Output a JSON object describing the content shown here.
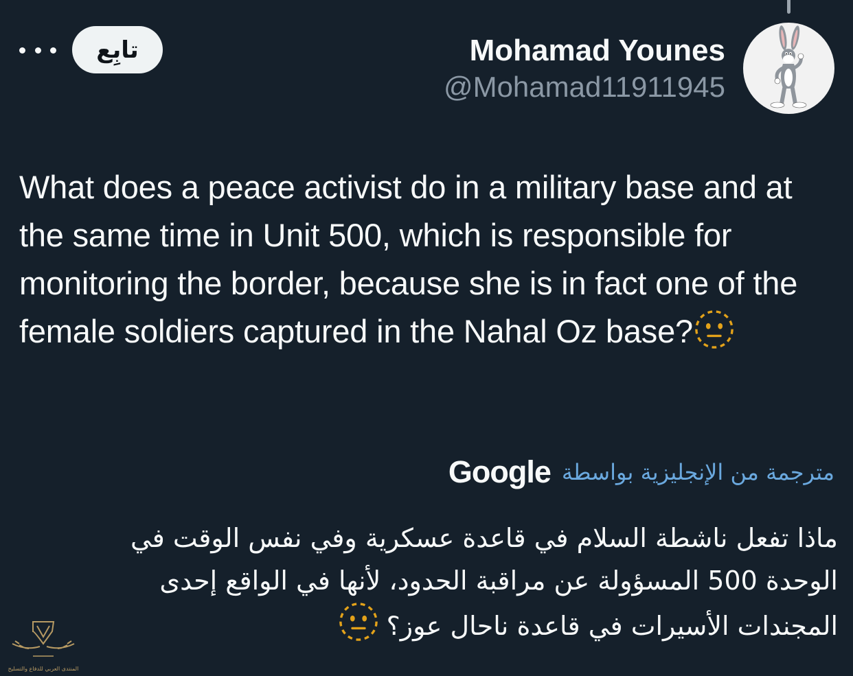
{
  "author": {
    "display_name": "Mohamad Younes",
    "handle": "@Mohamad11911945",
    "avatar_icon": "cartoon-rabbit-avatar"
  },
  "actions": {
    "follow_label": "تابِع",
    "more_icon": "more-horizontal-icon"
  },
  "tweet": {
    "text": "What does a peace activist do in a military base and at the same time in Unit 500, which is responsible for monitoring the border, because she is in fact one of the female soldiers captured in the Nahal Oz base?",
    "emoji": "neutral-face-dotted-emoji"
  },
  "translation": {
    "label": "مترجمة من الإنجليزية بواسطة",
    "provider": "Google",
    "text": "ماذا تفعل ناشطة السلام في قاعدة عسكرية وفي نفس الوقت في الوحدة 500 المسؤولة عن مراقبة الحدود، لأنها في الواقع إحدى المجندات الأسيرات في قاعدة ناحال عوز؟",
    "emoji": "neutral-face-dotted-emoji"
  },
  "watermark": {
    "text": "المنتدى العربي للدفاع والتسليح",
    "icon": "forum-logo-icon"
  },
  "colors": {
    "background": "#15202b",
    "primary_text": "#f7f9f9",
    "secondary_text": "#8b98a5",
    "link": "#6aa8de",
    "button_bg": "#eff3f4"
  }
}
